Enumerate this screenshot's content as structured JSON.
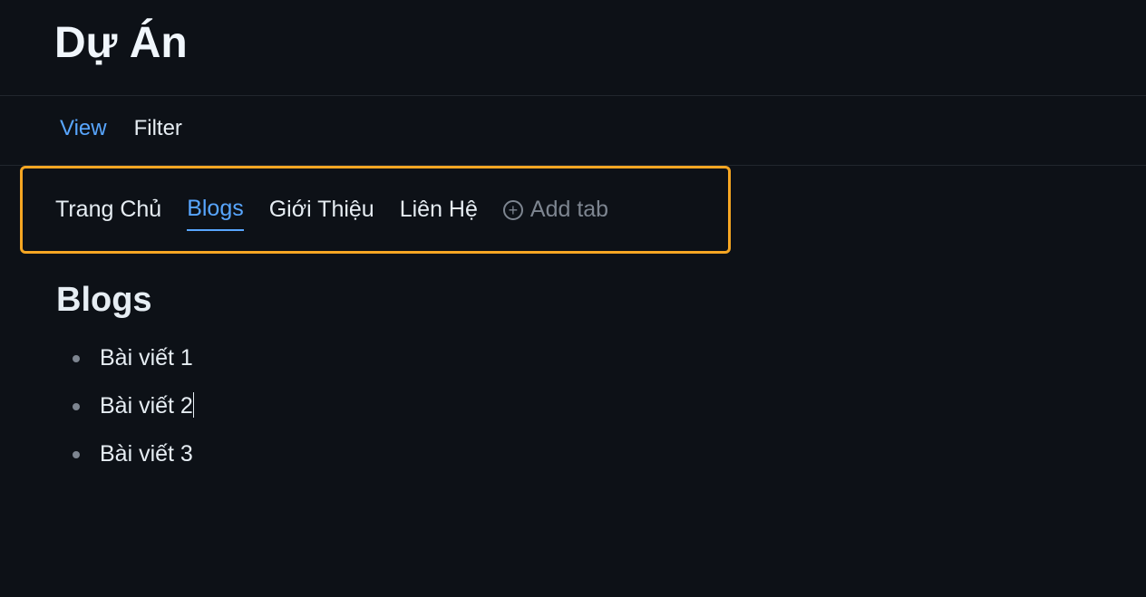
{
  "header": {
    "title": "Dự Án"
  },
  "toolbar": {
    "view_label": "View",
    "filter_label": "Filter"
  },
  "tabs": {
    "items": [
      {
        "label": "Trang Chủ",
        "active": false
      },
      {
        "label": "Blogs",
        "active": true
      },
      {
        "label": "Giới Thiệu",
        "active": false
      },
      {
        "label": "Liên Hệ",
        "active": false
      }
    ],
    "add_tab_label": "Add tab"
  },
  "content": {
    "section_title": "Blogs",
    "blog_items": [
      "Bài viết 1",
      "Bài viết 2",
      "Bài viết 3"
    ]
  }
}
